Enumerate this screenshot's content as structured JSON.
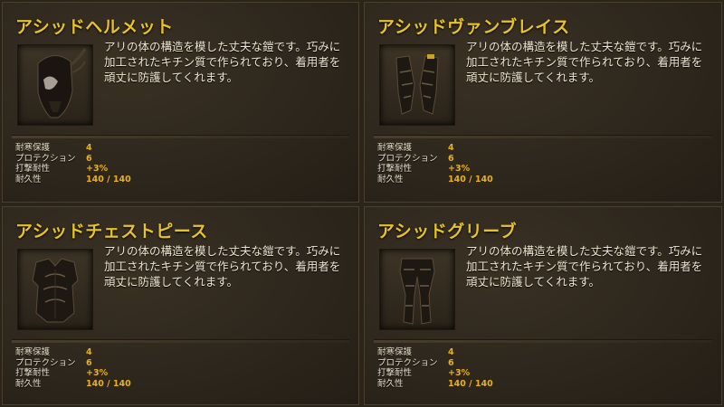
{
  "cards": [
    {
      "title": "アシッドヘルメット",
      "icon": "acid-helmet-icon",
      "description": "アリの体の構造を模した丈夫な鎧です。巧みに加工されたキチン質で作られており、着用者を頑丈に防護してくれます。",
      "stats": [
        {
          "label": "耐寒保護",
          "value": "4"
        },
        {
          "label": "プロテクション",
          "value": "6"
        },
        {
          "label": "打撃耐性",
          "value": "+3%"
        },
        {
          "label": "耐久性",
          "value": "140 / 140"
        }
      ]
    },
    {
      "title": "アシッドヴァンブレイス",
      "icon": "acid-vambraces-icon",
      "description": "アリの体の構造を模した丈夫な鎧です。巧みに加工されたキチン質で作られており、着用者を頑丈に防護してくれます。",
      "stats": [
        {
          "label": "耐寒保護",
          "value": "4"
        },
        {
          "label": "プロテクション",
          "value": "6"
        },
        {
          "label": "打撃耐性",
          "value": "+3%"
        },
        {
          "label": "耐久性",
          "value": "140 / 140"
        }
      ]
    },
    {
      "title": "アシッドチェストピース",
      "icon": "acid-chestpiece-icon",
      "description": "アリの体の構造を模した丈夫な鎧です。巧みに加工されたキチン質で作られており、着用者を頑丈に防護してくれます。",
      "stats": [
        {
          "label": "耐寒保護",
          "value": "4"
        },
        {
          "label": "プロテクション",
          "value": "6"
        },
        {
          "label": "打撃耐性",
          "value": "+3%"
        },
        {
          "label": "耐久性",
          "value": "140 / 140"
        }
      ]
    },
    {
      "title": "アシッドグリーブ",
      "icon": "acid-greaves-icon",
      "description": "アリの体の構造を模した丈夫な鎧です。巧みに加工されたキチン質で作られており、着用者を頑丈に防護してくれます。",
      "stats": [
        {
          "label": "耐寒保護",
          "value": "4"
        },
        {
          "label": "プロテクション",
          "value": "6"
        },
        {
          "label": "打撃耐性",
          "value": "+3%"
        },
        {
          "label": "耐久性",
          "value": "140 / 140"
        }
      ]
    }
  ],
  "colors": {
    "title": "#e8c22a",
    "stat_value": "#e8b020",
    "text": "#efe6d2",
    "panel": "#2e271d"
  }
}
